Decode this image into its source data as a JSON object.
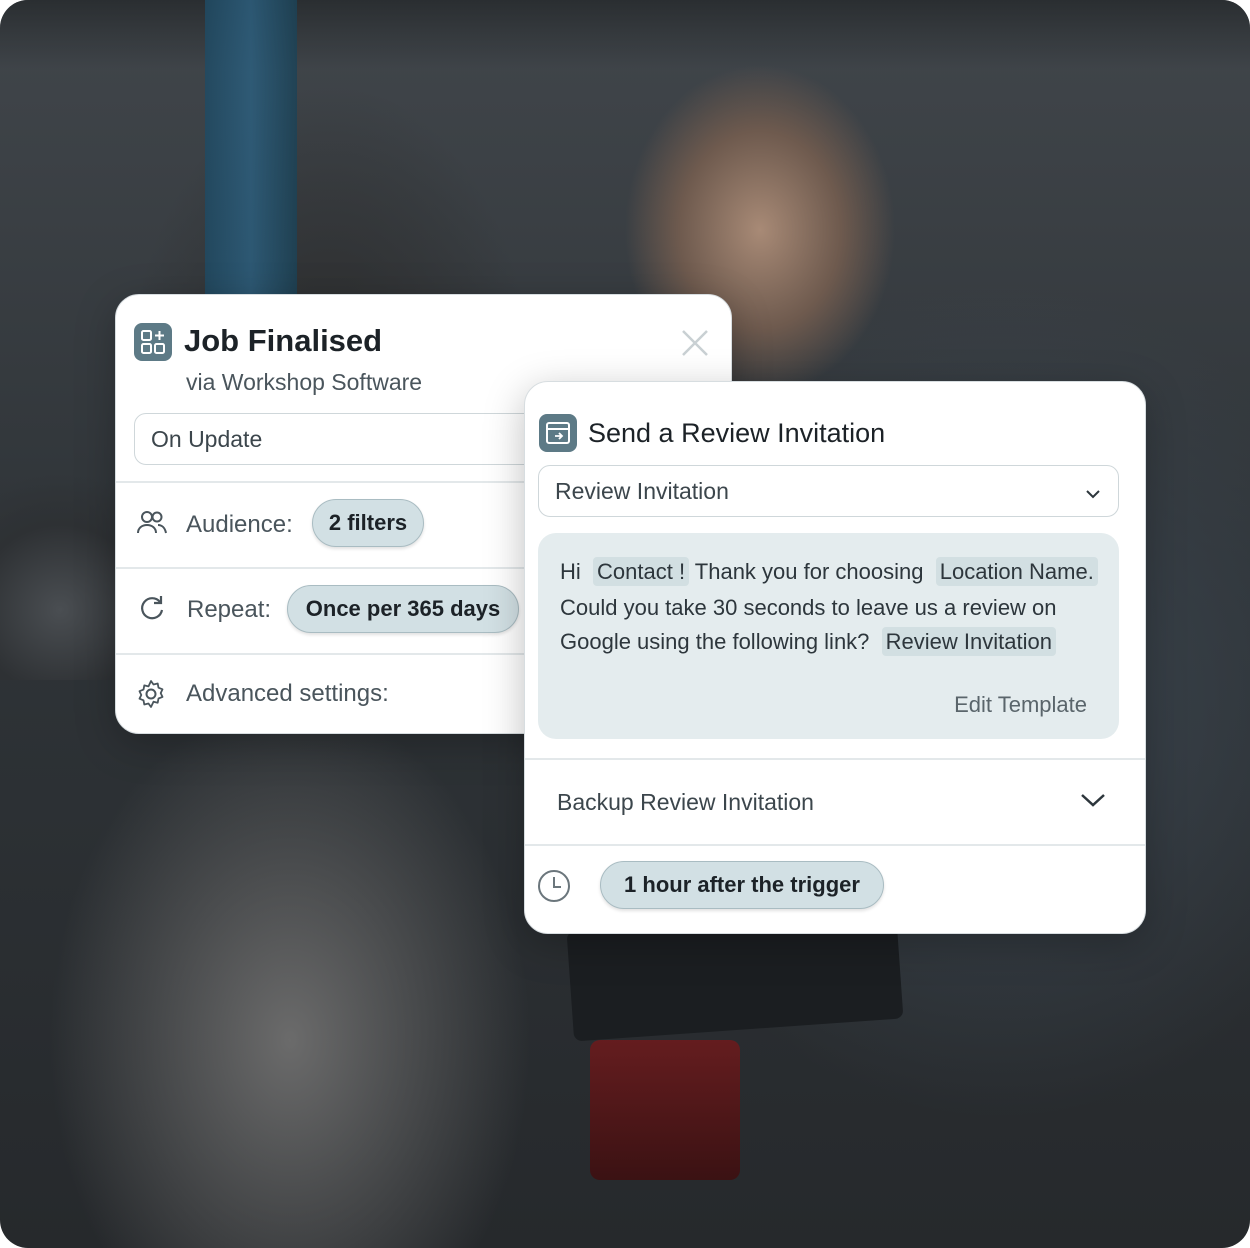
{
  "job_card": {
    "title": "Job Finalised",
    "subtitle": "via Workshop Software",
    "trigger_field": "On Update",
    "audience_label": "Audience:",
    "audience_value": "2 filters",
    "repeat_label": "Repeat:",
    "repeat_value": "Once per 365 days",
    "advanced_label": "Advanced settings:"
  },
  "review_card": {
    "title": "Send a Review Invitation",
    "template_select": "Review Invitation",
    "message": {
      "greeting": "Hi",
      "contact_tag": "Contact !",
      "thanks": "Thank you for choosing",
      "location_tag": "Location Name.",
      "line2": "Could you take 30 seconds to leave us a review on",
      "line3": "Google using the following link?",
      "link_tag": "Review Invitation"
    },
    "edit_template": "Edit Template",
    "backup_label": "Backup Review Invitation",
    "delay_value": "1 hour after the trigger"
  },
  "colors": {
    "accent_icon_bg": "#5d7a86",
    "pill_bg": "#d2e0e4",
    "message_bg": "#e4ecee"
  }
}
